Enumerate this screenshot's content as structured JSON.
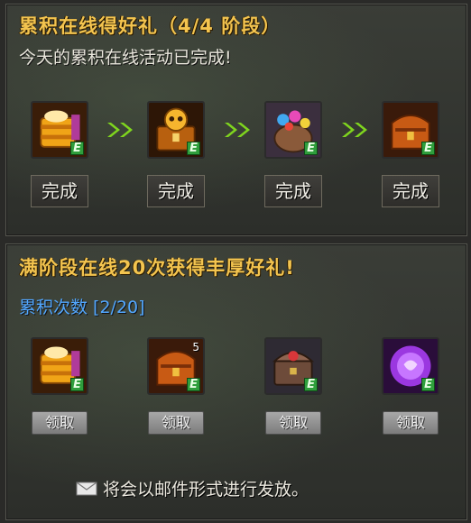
{
  "section1": {
    "title": "累积在线得好礼（4/4 阶段）",
    "status": "今天的累积在线活动已完成!",
    "stages": [
      {
        "icon": "golden-package-icon",
        "badge": "E",
        "button": "完成"
      },
      {
        "icon": "golden-skull-chest-icon",
        "badge": "E",
        "button": "完成"
      },
      {
        "icon": "gem-pouch-icon",
        "badge": "E",
        "button": "完成"
      },
      {
        "icon": "leather-bag-icon",
        "badge": "E",
        "button": "完成"
      }
    ],
    "arrow_icon": "double-chevron-right-icon"
  },
  "section2": {
    "title": "满阶段在线20次获得丰厚好礼!",
    "count_label": "累积次数 [2/20]",
    "rewards": [
      {
        "icon": "golden-package-icon",
        "badge": "E",
        "qty": "",
        "button": "领取"
      },
      {
        "icon": "leather-bag-icon",
        "badge": "E",
        "qty": "5",
        "button": "领取"
      },
      {
        "icon": "treasure-chest-icon",
        "badge": "E",
        "qty": "",
        "button": "领取"
      },
      {
        "icon": "purple-orb-icon",
        "badge": "E",
        "qty": "",
        "button": "领取"
      }
    ]
  },
  "footer": {
    "icon": "mail-envelope-icon",
    "text": "将会以邮件形式进行发放。"
  },
  "colors": {
    "title": "#f3c44f",
    "count": "#52a7ff",
    "arrow": "#7fd51e",
    "badge": "#2f9e3c"
  }
}
